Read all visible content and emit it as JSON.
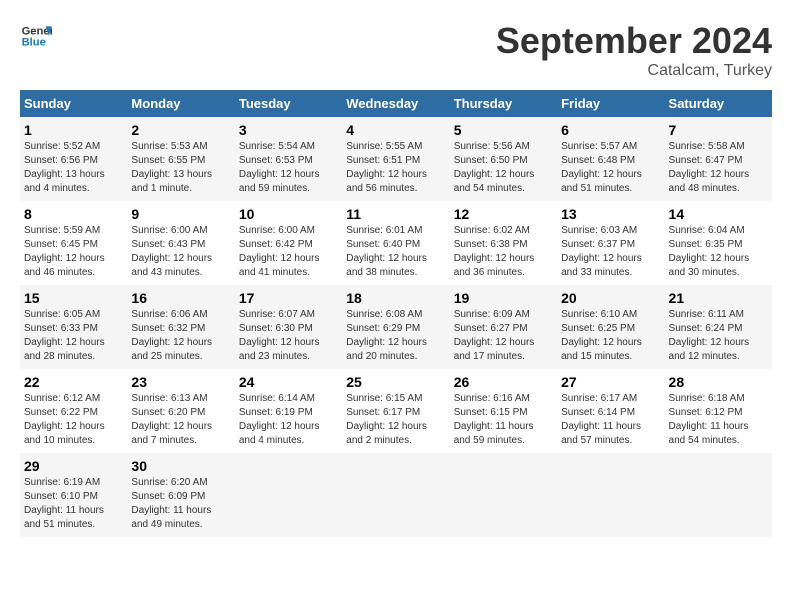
{
  "header": {
    "logo_line1": "General",
    "logo_line2": "Blue",
    "month": "September 2024",
    "location": "Catalcam, Turkey"
  },
  "weekdays": [
    "Sunday",
    "Monday",
    "Tuesday",
    "Wednesday",
    "Thursday",
    "Friday",
    "Saturday"
  ],
  "weeks": [
    [
      {
        "day": "1",
        "info": "Sunrise: 5:52 AM\nSunset: 6:56 PM\nDaylight: 13 hours\nand 4 minutes."
      },
      {
        "day": "2",
        "info": "Sunrise: 5:53 AM\nSunset: 6:55 PM\nDaylight: 13 hours\nand 1 minute."
      },
      {
        "day": "3",
        "info": "Sunrise: 5:54 AM\nSunset: 6:53 PM\nDaylight: 12 hours\nand 59 minutes."
      },
      {
        "day": "4",
        "info": "Sunrise: 5:55 AM\nSunset: 6:51 PM\nDaylight: 12 hours\nand 56 minutes."
      },
      {
        "day": "5",
        "info": "Sunrise: 5:56 AM\nSunset: 6:50 PM\nDaylight: 12 hours\nand 54 minutes."
      },
      {
        "day": "6",
        "info": "Sunrise: 5:57 AM\nSunset: 6:48 PM\nDaylight: 12 hours\nand 51 minutes."
      },
      {
        "day": "7",
        "info": "Sunrise: 5:58 AM\nSunset: 6:47 PM\nDaylight: 12 hours\nand 48 minutes."
      }
    ],
    [
      {
        "day": "8",
        "info": "Sunrise: 5:59 AM\nSunset: 6:45 PM\nDaylight: 12 hours\nand 46 minutes."
      },
      {
        "day": "9",
        "info": "Sunrise: 6:00 AM\nSunset: 6:43 PM\nDaylight: 12 hours\nand 43 minutes."
      },
      {
        "day": "10",
        "info": "Sunrise: 6:00 AM\nSunset: 6:42 PM\nDaylight: 12 hours\nand 41 minutes."
      },
      {
        "day": "11",
        "info": "Sunrise: 6:01 AM\nSunset: 6:40 PM\nDaylight: 12 hours\nand 38 minutes."
      },
      {
        "day": "12",
        "info": "Sunrise: 6:02 AM\nSunset: 6:38 PM\nDaylight: 12 hours\nand 36 minutes."
      },
      {
        "day": "13",
        "info": "Sunrise: 6:03 AM\nSunset: 6:37 PM\nDaylight: 12 hours\nand 33 minutes."
      },
      {
        "day": "14",
        "info": "Sunrise: 6:04 AM\nSunset: 6:35 PM\nDaylight: 12 hours\nand 30 minutes."
      }
    ],
    [
      {
        "day": "15",
        "info": "Sunrise: 6:05 AM\nSunset: 6:33 PM\nDaylight: 12 hours\nand 28 minutes."
      },
      {
        "day": "16",
        "info": "Sunrise: 6:06 AM\nSunset: 6:32 PM\nDaylight: 12 hours\nand 25 minutes."
      },
      {
        "day": "17",
        "info": "Sunrise: 6:07 AM\nSunset: 6:30 PM\nDaylight: 12 hours\nand 23 minutes."
      },
      {
        "day": "18",
        "info": "Sunrise: 6:08 AM\nSunset: 6:29 PM\nDaylight: 12 hours\nand 20 minutes."
      },
      {
        "day": "19",
        "info": "Sunrise: 6:09 AM\nSunset: 6:27 PM\nDaylight: 12 hours\nand 17 minutes."
      },
      {
        "day": "20",
        "info": "Sunrise: 6:10 AM\nSunset: 6:25 PM\nDaylight: 12 hours\nand 15 minutes."
      },
      {
        "day": "21",
        "info": "Sunrise: 6:11 AM\nSunset: 6:24 PM\nDaylight: 12 hours\nand 12 minutes."
      }
    ],
    [
      {
        "day": "22",
        "info": "Sunrise: 6:12 AM\nSunset: 6:22 PM\nDaylight: 12 hours\nand 10 minutes."
      },
      {
        "day": "23",
        "info": "Sunrise: 6:13 AM\nSunset: 6:20 PM\nDaylight: 12 hours\nand 7 minutes."
      },
      {
        "day": "24",
        "info": "Sunrise: 6:14 AM\nSunset: 6:19 PM\nDaylight: 12 hours\nand 4 minutes."
      },
      {
        "day": "25",
        "info": "Sunrise: 6:15 AM\nSunset: 6:17 PM\nDaylight: 12 hours\nand 2 minutes."
      },
      {
        "day": "26",
        "info": "Sunrise: 6:16 AM\nSunset: 6:15 PM\nDaylight: 11 hours\nand 59 minutes."
      },
      {
        "day": "27",
        "info": "Sunrise: 6:17 AM\nSunset: 6:14 PM\nDaylight: 11 hours\nand 57 minutes."
      },
      {
        "day": "28",
        "info": "Sunrise: 6:18 AM\nSunset: 6:12 PM\nDaylight: 11 hours\nand 54 minutes."
      }
    ],
    [
      {
        "day": "29",
        "info": "Sunrise: 6:19 AM\nSunset: 6:10 PM\nDaylight: 11 hours\nand 51 minutes."
      },
      {
        "day": "30",
        "info": "Sunrise: 6:20 AM\nSunset: 6:09 PM\nDaylight: 11 hours\nand 49 minutes."
      },
      {
        "day": "",
        "info": ""
      },
      {
        "day": "",
        "info": ""
      },
      {
        "day": "",
        "info": ""
      },
      {
        "day": "",
        "info": ""
      },
      {
        "day": "",
        "info": ""
      }
    ]
  ]
}
